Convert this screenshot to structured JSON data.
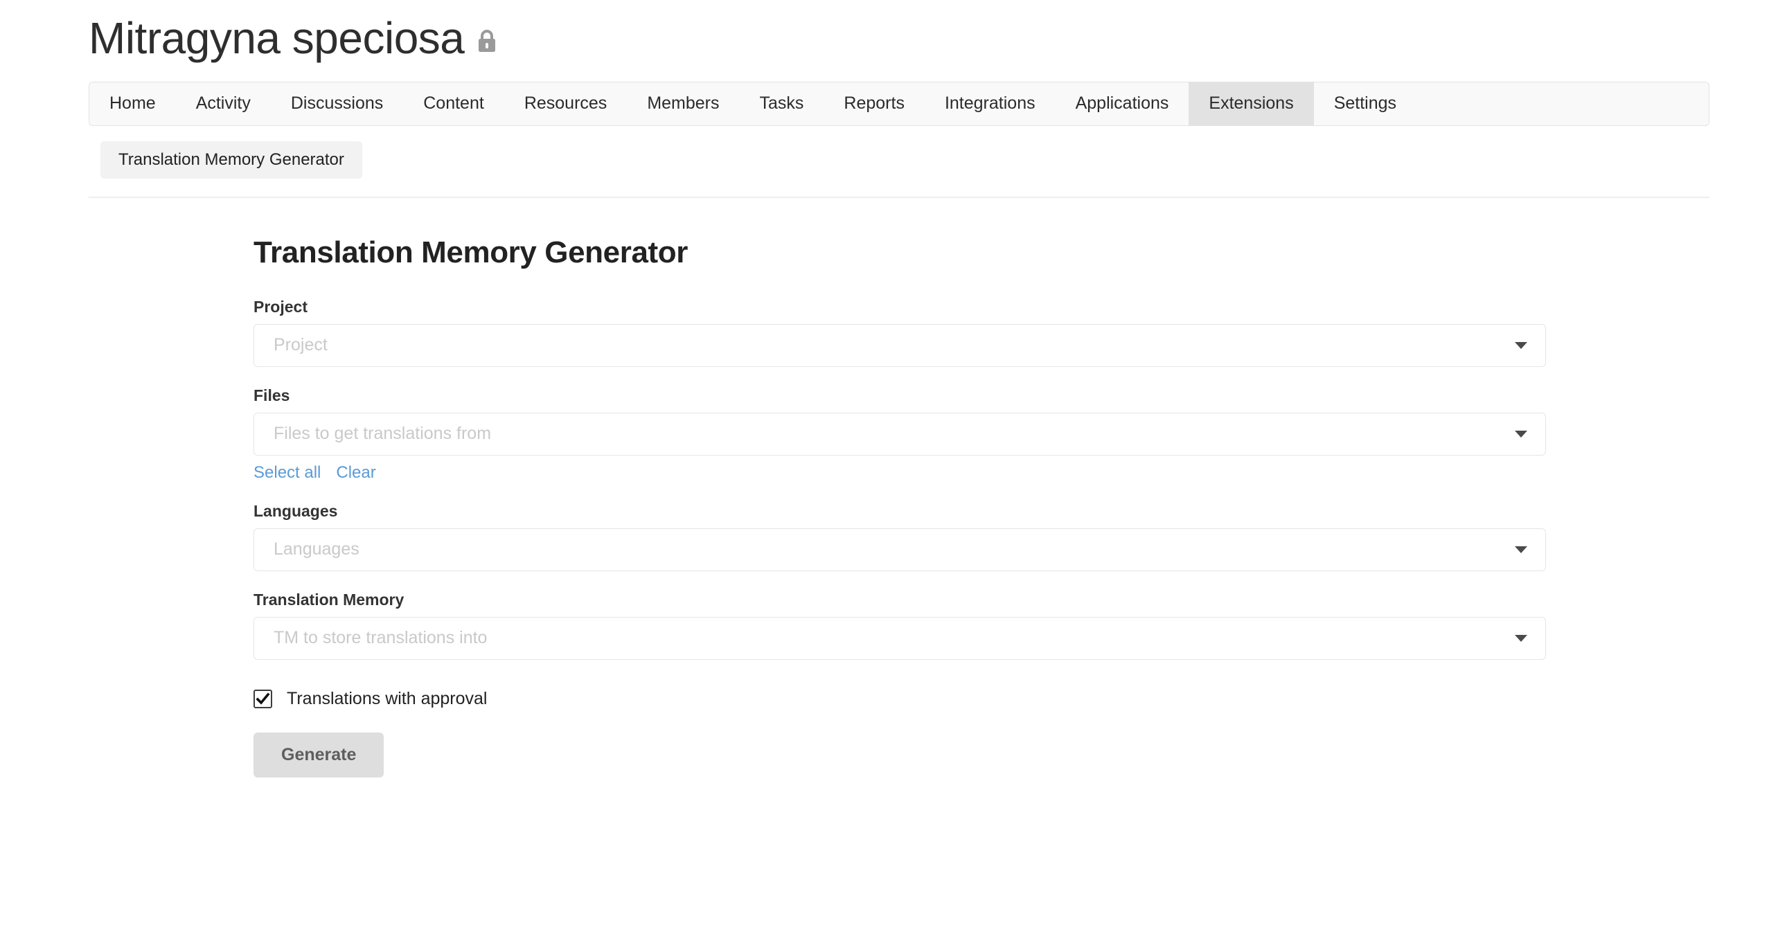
{
  "header": {
    "title": "Mitragyna speciosa",
    "lock_icon": "lock-icon"
  },
  "nav": {
    "items": [
      {
        "label": "Home",
        "active": false
      },
      {
        "label": "Activity",
        "active": false
      },
      {
        "label": "Discussions",
        "active": false
      },
      {
        "label": "Content",
        "active": false
      },
      {
        "label": "Resources",
        "active": false
      },
      {
        "label": "Members",
        "active": false
      },
      {
        "label": "Tasks",
        "active": false
      },
      {
        "label": "Reports",
        "active": false
      },
      {
        "label": "Integrations",
        "active": false
      },
      {
        "label": "Applications",
        "active": false
      },
      {
        "label": "Extensions",
        "active": true
      },
      {
        "label": "Settings",
        "active": false
      }
    ]
  },
  "subnav": {
    "items": [
      {
        "label": "Translation Memory Generator"
      }
    ]
  },
  "form": {
    "title": "Translation Memory Generator",
    "fields": [
      {
        "label": "Project",
        "placeholder": "Project",
        "icon": "chevron-down-icon"
      },
      {
        "label": "Files",
        "placeholder": "Files to get translations from",
        "icon": "chevron-down-icon"
      },
      {
        "label": "Languages",
        "placeholder": "Languages",
        "icon": "chevron-down-icon"
      },
      {
        "label": "Translation Memory",
        "placeholder": "TM to store translations into",
        "icon": "chevron-down-icon"
      }
    ],
    "file_links": [
      {
        "label": "Select all"
      },
      {
        "label": "Clear"
      }
    ],
    "checkbox": {
      "label": "Translations with approval",
      "checked": true
    },
    "submit_label": "Generate"
  },
  "colors": {
    "link": "#5b9bd5",
    "active_tab_bg": "#e2e2e2",
    "button_bg": "#dedede",
    "placeholder": "#c9c9c9"
  }
}
